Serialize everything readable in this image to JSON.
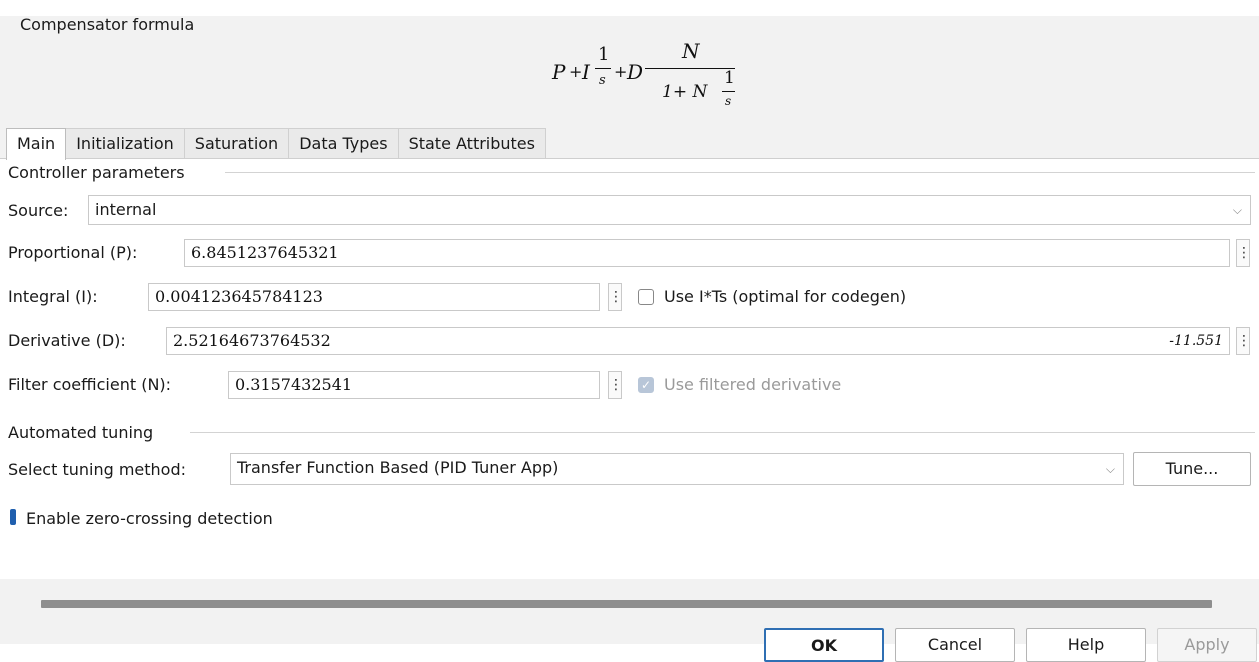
{
  "compensator": {
    "title": "Compensator formula",
    "formula": {
      "P": "P",
      "plus": "+",
      "I": "I",
      "one": "1",
      "s": "s",
      "D": "D",
      "N": "N",
      "den_prefix": "1+ N"
    }
  },
  "tabs": [
    {
      "label": "Main"
    },
    {
      "label": "Initialization"
    },
    {
      "label": "Saturation"
    },
    {
      "label": "Data Types"
    },
    {
      "label": "State Attributes"
    }
  ],
  "controller": {
    "section_label": "Controller parameters",
    "source_label": "Source:",
    "source_value": "internal",
    "proportional_label": "Proportional (P):",
    "proportional_value": "6.8451237645321",
    "integral_label": "Integral (I):",
    "integral_value": "0.004123645784123",
    "use_its_label": "Use I*Ts (optimal for codegen)",
    "derivative_label": "Derivative (D):",
    "derivative_value": "2.52164673764532",
    "derivative_readout": "-11.551",
    "filter_label": "Filter coefficient (N):",
    "filter_value": "0.3157432541",
    "use_filtered_label": "Use filtered derivative"
  },
  "tuning": {
    "section_label": "Automated tuning",
    "method_label": "Select tuning method:",
    "method_value": "Transfer Function Based (PID Tuner App)",
    "tune_button": "Tune..."
  },
  "zero_crossing_label": "Enable zero-crossing detection",
  "buttons": {
    "ok": "OK",
    "cancel": "Cancel",
    "help": "Help",
    "apply": "Apply"
  },
  "icons": {
    "more_menu": "⋮",
    "chevron": "⌵"
  }
}
